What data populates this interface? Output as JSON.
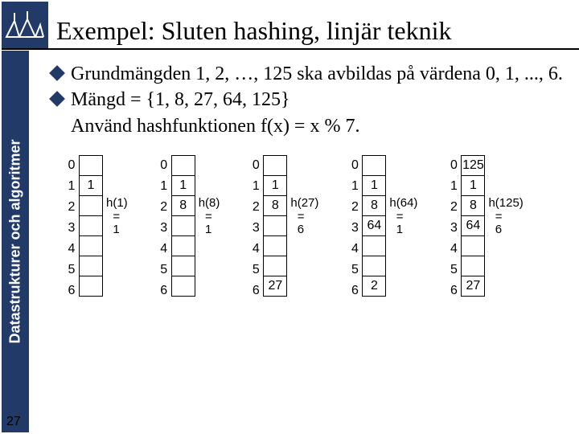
{
  "sidebar_label": "Datastrukturer och algoritmer",
  "title": "Exempel: Sluten hashing, linjär teknik",
  "bullets": {
    "b1a": "Grundmängden",
    "b1b": " 1, 2, …, 125 ska avbildas på värdena 0, 1, ..., 6.",
    "b2a": "Mängd",
    "b2b": " = {1, 8, 27, 64, 125}",
    "b3": "Använd hashfunktionen f(x) = x % 7."
  },
  "indices": [
    "0",
    "1",
    "2",
    "3",
    "4",
    "5",
    "6"
  ],
  "tables": [
    {
      "cells": [
        "",
        "1",
        "",
        "",
        "",
        "",
        ""
      ],
      "annot": "h(1)\n  =\n  1"
    },
    {
      "cells": [
        "",
        "1",
        "8",
        "",
        "",
        "",
        ""
      ],
      "annot": "h(8)\n  =\n  1"
    },
    {
      "cells": [
        "",
        "1",
        "8",
        "",
        "",
        "",
        "27"
      ],
      "annot": "h(27)\n  =\n  6"
    },
    {
      "cells": [
        "",
        "1",
        "8",
        "64",
        "",
        "",
        "2"
      ],
      "annot": "h(64)\n  =\n  1"
    },
    {
      "cells": [
        "125",
        "1",
        "8",
        "64",
        "",
        "",
        "27"
      ],
      "annot": "h(125)\n  =\n  6"
    }
  ],
  "slide_number": "27"
}
